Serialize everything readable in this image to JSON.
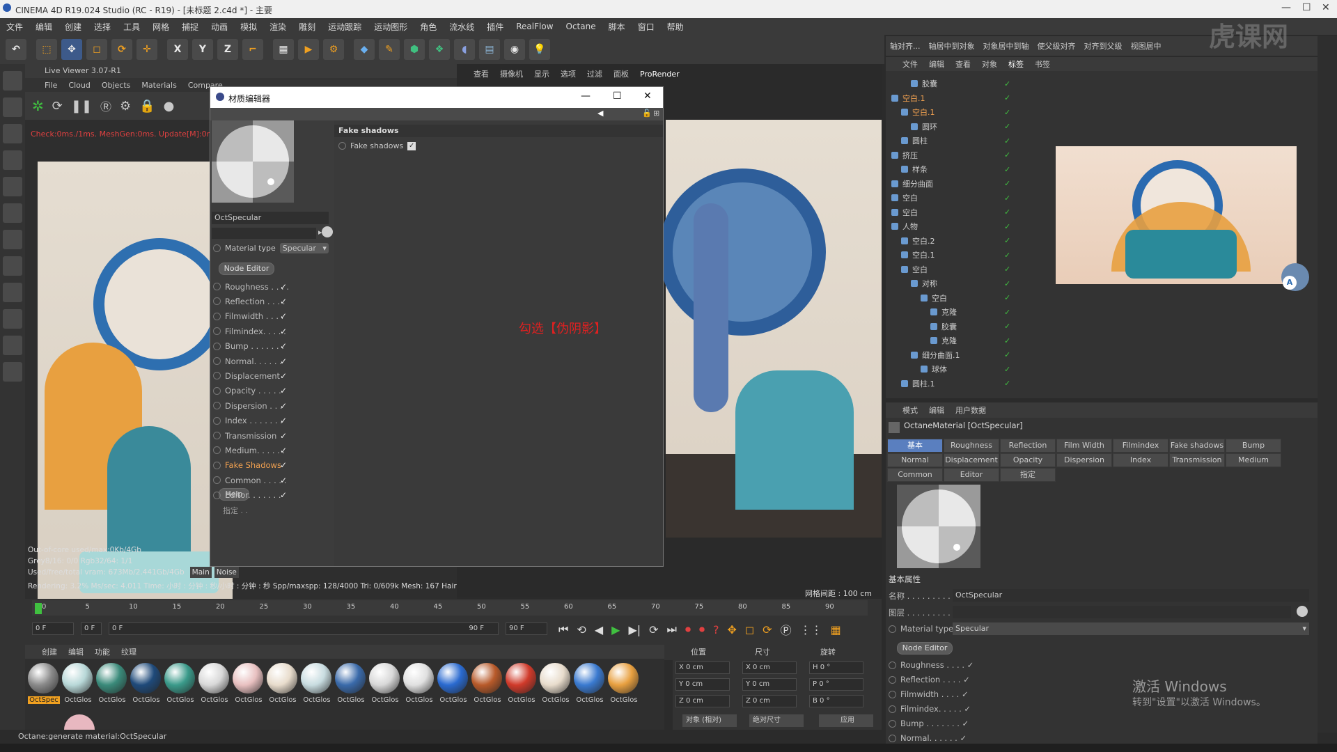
{
  "app": {
    "title": "CINEMA 4D R19.024 Studio (RC - R19) - [未标题 2.c4d *] - 主要",
    "window_controls": [
      "—",
      "☐",
      "✕"
    ]
  },
  "menubar": [
    "文件",
    "编辑",
    "创建",
    "选择",
    "工具",
    "网格",
    "捕捉",
    "动画",
    "模拟",
    "渲染",
    "雕刻",
    "运动跟踪",
    "运动图形",
    "角色",
    "流水线",
    "插件",
    "RealFlow",
    "Octane",
    "脚本",
    "窗口",
    "帮助"
  ],
  "toolbar": {
    "buttons": [
      "undo",
      "select",
      "move",
      "scale",
      "rotate",
      "axis",
      "X",
      "Y",
      "Z",
      "coord",
      "render-view",
      "render",
      "render-settings",
      "cube",
      "pen",
      "subdivision",
      "array",
      "deformer",
      "floor",
      "camera",
      "light"
    ]
  },
  "live_viewer": {
    "title": "Live Viewer 3.07-R1",
    "menu": [
      "File",
      "Cloud",
      "Objects",
      "Materials",
      "Compare"
    ],
    "status": "Check:0ms./1ms. MeshGen:0ms. Update[M]:0ms.",
    "stats": [
      "Out-of-core used/max:0Kb/4Gb",
      "Grey8/16: 0/0          Rgb32/64: 1/1",
      "Used/free/total vram: 673Mb/2.441Gb/4Gb"
    ],
    "stat_tabs": [
      "Main",
      "Noise"
    ],
    "rendering": "Rendering: 3.2%    Ms/sec: 4.011    Time: 小时 : 分钟 : 秒/小时 : 分钟 : 秒    Spp/maxspp: 128/4000    Tri: 0/609k    Mesh: 167  Hair"
  },
  "viewport": {
    "menu": [
      "查看",
      "摄像机",
      "显示",
      "选项",
      "过滤",
      "面板",
      "ProRender"
    ],
    "grid_spacing": "网格间距 : 100 cm"
  },
  "material_editor": {
    "title": "材质编辑器",
    "material_name": "OctSpecular",
    "material_type_label": "Material type",
    "material_type_value": "Specular",
    "node_editor_label": "Node Editor",
    "channels": [
      {
        "label": "Roughness . . . .",
        "checked": "✓"
      },
      {
        "label": "Reflection . . . .",
        "checked": "✓"
      },
      {
        "label": "Filmwidth . . . .",
        "checked": "✓"
      },
      {
        "label": "Filmindex. . . . .",
        "checked": "✓"
      },
      {
        "label": "Bump . . . . . . .",
        "checked": "✓"
      },
      {
        "label": "Normal. . . . . .",
        "checked": "✓"
      },
      {
        "label": "Displacement",
        "checked": "✓"
      },
      {
        "label": "Opacity . . . . .",
        "checked": "✓"
      },
      {
        "label": "Dispersion . . .",
        "checked": "✓"
      },
      {
        "label": "Index . . . . . . .",
        "checked": "✓"
      },
      {
        "label": "Transmission",
        "checked": "✓"
      },
      {
        "label": "Medium. . . . . .",
        "checked": "✓"
      },
      {
        "label": "Fake Shadows",
        "checked": "✓"
      },
      {
        "label": "Common . . . . .",
        "checked": "✓"
      },
      {
        "label": "Editor. . . . . . .",
        "checked": "✓"
      }
    ],
    "help_label": "Help",
    "assign_label": "指定 . .",
    "section_title": "Fake shadows",
    "fake_shadows_param": "Fake shadows",
    "annotation": "勾选【伪阴影】",
    "accent": "#f0a050",
    "annotation_color": "#e02020"
  },
  "timeline": {
    "ticks": [
      "0",
      "5",
      "10",
      "15",
      "20",
      "25",
      "30",
      "35",
      "40",
      "45",
      "50",
      "55",
      "60",
      "65",
      "70",
      "75",
      "80",
      "85",
      "90"
    ],
    "current_frame": "0 F",
    "start": "0 F",
    "range_start": "0 F",
    "range_end": "90 F",
    "end": "90 F"
  },
  "material_bar": {
    "menu": [
      "创建",
      "编辑",
      "功能",
      "纹理"
    ],
    "materials": [
      {
        "label": "OctSpec",
        "color": "#8a8a8a",
        "active": true
      },
      {
        "label": "OctGlos",
        "color": "#b8d8d8"
      },
      {
        "label": "OctGlos",
        "color": "#3a8a7a"
      },
      {
        "label": "OctGlos",
        "color": "#1f4a7a"
      },
      {
        "label": "OctGlos",
        "color": "#3a9a8a"
      },
      {
        "label": "OctGlos",
        "color": "#d8d8d8"
      },
      {
        "label": "OctGlos",
        "color": "#e8c0c0"
      },
      {
        "label": "OctGlos",
        "color": "#e8dccc"
      },
      {
        "label": "OctGlos",
        "color": "#c8dce0"
      },
      {
        "label": "OctGlos",
        "color": "#3a6aaa"
      },
      {
        "label": "OctGlos",
        "color": "#d8d8d8"
      },
      {
        "label": "OctGlos",
        "color": "#e0e0e0"
      },
      {
        "label": "OctGlos",
        "color": "#2a6ad0"
      },
      {
        "label": "OctGlos",
        "color": "#b85a2a"
      },
      {
        "label": "OctGlos",
        "color": "#d03a2a"
      },
      {
        "label": "OctGlos",
        "color": "#e8dccc"
      },
      {
        "label": "OctGlos",
        "color": "#3a7ad0"
      },
      {
        "label": "OctGlos",
        "color": "#e8a040"
      }
    ]
  },
  "coords": {
    "headers": [
      "位置",
      "尺寸",
      "旋转"
    ],
    "pos": [
      "X  0 cm",
      "Y  0 cm",
      "Z  0 cm"
    ],
    "size": [
      "X  0 cm",
      "Y  0 cm",
      "Z  0 cm"
    ],
    "rot": [
      "H  0 °",
      "P  0 °",
      "B  0 °"
    ],
    "mode_a": "对象 (相对)",
    "mode_b": "绝对尺寸",
    "apply": "应用"
  },
  "statusbar": "Octane:generate material:OctSpecular",
  "object_manager": {
    "toolbar": [
      "轴对齐...",
      "轴居中到对象",
      "对象居中到轴",
      "使父级对齐",
      "对齐到父级",
      "视图居中"
    ],
    "menu": [
      "文件",
      "编辑",
      "查看",
      "对象",
      "标签",
      "书签"
    ],
    "rows": [
      {
        "label": "胶囊",
        "indent": 2
      },
      {
        "label": "空白.1",
        "indent": 0,
        "active": true
      },
      {
        "label": "空白.1",
        "indent": 1,
        "active": true
      },
      {
        "label": "圆环",
        "indent": 2
      },
      {
        "label": "圆柱",
        "indent": 1
      },
      {
        "label": "挤压",
        "indent": 0
      },
      {
        "label": "样条",
        "indent": 1
      },
      {
        "label": "细分曲面",
        "indent": 0
      },
      {
        "label": "空白",
        "indent": 0
      },
      {
        "label": "空白",
        "indent": 0
      },
      {
        "label": "人物",
        "indent": 0
      },
      {
        "label": "空白.2",
        "indent": 1
      },
      {
        "label": "空白.1",
        "indent": 1
      },
      {
        "label": "空白",
        "indent": 1
      },
      {
        "label": "对称",
        "indent": 2
      },
      {
        "label": "空白",
        "indent": 3
      },
      {
        "label": "克隆",
        "indent": 4
      },
      {
        "label": "胶囊",
        "indent": 4
      },
      {
        "label": "克隆",
        "indent": 4
      },
      {
        "label": "细分曲面.1",
        "indent": 2
      },
      {
        "label": "球体",
        "indent": 3
      },
      {
        "label": "圆柱.1",
        "indent": 1
      }
    ]
  },
  "attribute_manager": {
    "menu": [
      "模式",
      "编辑",
      "用户数据"
    ],
    "title": "OctaneMaterial [OctSpecular]",
    "tabs": [
      "基本",
      "Roughness",
      "Reflection",
      "Film Width",
      "Filmindex",
      "Fake shadows",
      "Bump",
      "Normal",
      "Displacement",
      "Opacity",
      "Dispersion",
      "Index",
      "Transmission",
      "Medium",
      "Common",
      "Editor",
      "指定"
    ],
    "basic_title": "基本属性",
    "name_label": "名称 . . . . . . . . .",
    "name_value": "OctSpecular",
    "layer_label": "图层 . . . . . . . . .",
    "material_type_label": "Material type",
    "material_type_value": "Specular",
    "node_editor_label": "Node Editor",
    "channels": [
      "Roughness . . . . ✓",
      "Reflection . . . . ✓",
      "Filmwidth . . . . ✓",
      "Filmindex. . . . . ✓",
      "Bump . . . . . . . ✓",
      "Normal. . . . . . ✓"
    ],
    "active_tab_color": "#5a7fbf"
  },
  "watermark": {
    "line1": "激活 Windows",
    "line2": "转到\"设置\"以激活 Windows。",
    "logo": "虎课网"
  }
}
